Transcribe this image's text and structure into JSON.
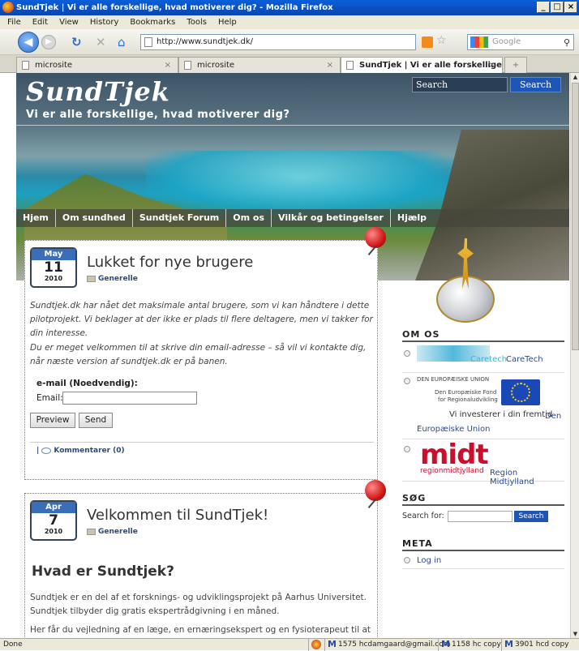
{
  "window": {
    "title": "SundTjek | Vi er alle forskellige, hvad motiverer dig? - Mozilla Firefox"
  },
  "menu": [
    "File",
    "Edit",
    "View",
    "History",
    "Bookmarks",
    "Tools",
    "Help"
  ],
  "toolbar": {
    "url": "http://www.sundtjek.dk/",
    "search_placeholder": "Google"
  },
  "tabs": [
    {
      "label": "microsite",
      "active": false
    },
    {
      "label": "microsite",
      "active": false
    },
    {
      "label": "SundTjek | Vi er alle forskellige, ...",
      "active": true
    }
  ],
  "site": {
    "title": "SundTjek",
    "tagline": "Vi er alle forskellige, hvad motiverer dig?",
    "search_placeholder": "Search",
    "search_button": "Search"
  },
  "nav": [
    "Hjem",
    "Om sundhed",
    "Sundtjek Forum",
    "Om os",
    "Vilkår og betingelser",
    "Hjælp"
  ],
  "posts": [
    {
      "month": "May",
      "day": "11",
      "year": "2010",
      "title": "Lukket for nye brugere",
      "category": "Generelle",
      "para1": "Sundtjek.dk har nået det maksimale antal brugere, som vi kan håndtere i dette pilotprojekt. Vi beklager at der ikke er plads til flere deltagere, men vi takker for din interesse.",
      "para2": "Du er meget velkommen til at skrive din email-adresse – så vil vi kontakte dig, når næste version af sundtjek.dk er på banen.",
      "email_heading": "e-mail (Noedvendig):",
      "email_label": "Email:",
      "preview_button": "Preview",
      "send_button": "Send",
      "comments": "Kommentarer (0)"
    },
    {
      "month": "Apr",
      "day": "7",
      "year": "2010",
      "title": "Velkommen til SundTjek!",
      "category": "Generelle",
      "heading": "Hvad er Sundtjek?",
      "para1": "Sundtjek er en del af et forsknings- og udviklingsprojekt på Aarhus Universitet. Sundtjek tilbyder dig gratis ekspertrådgivning i en måned.",
      "para2": "Her får du vejledning af en læge, en ernæringsekspert og en fysioterapeut til at ændre din livsstil"
    }
  ],
  "sidebar": {
    "om_os_heading": "OM OS",
    "caretech_logo_text": "Caretech",
    "caretech_link": "CareTech",
    "eu_line1": "DEN EUROPÆISKE UNION",
    "eu_line2": "Den Europæiske Fond",
    "eu_line3": "for Regionaludvikling",
    "eu_invest": "Vi investerer i din fremtid",
    "eu_link_part1": "Den",
    "eu_link_part2": "Europæiske Union",
    "midt_logo": "midt",
    "midt_sub": "regionmidtjylland",
    "midt_link": "Region Midtjylland",
    "sog_heading": "SØG",
    "search_for": "Search for:",
    "search_button": "Search",
    "meta_heading": "META",
    "login": "Log in"
  },
  "status": {
    "left": "Done",
    "mail1": "1575 hcdamgaard@gmail.com",
    "mail2": "1158 hc copy",
    "mail3": "3901 hcd copy"
  }
}
